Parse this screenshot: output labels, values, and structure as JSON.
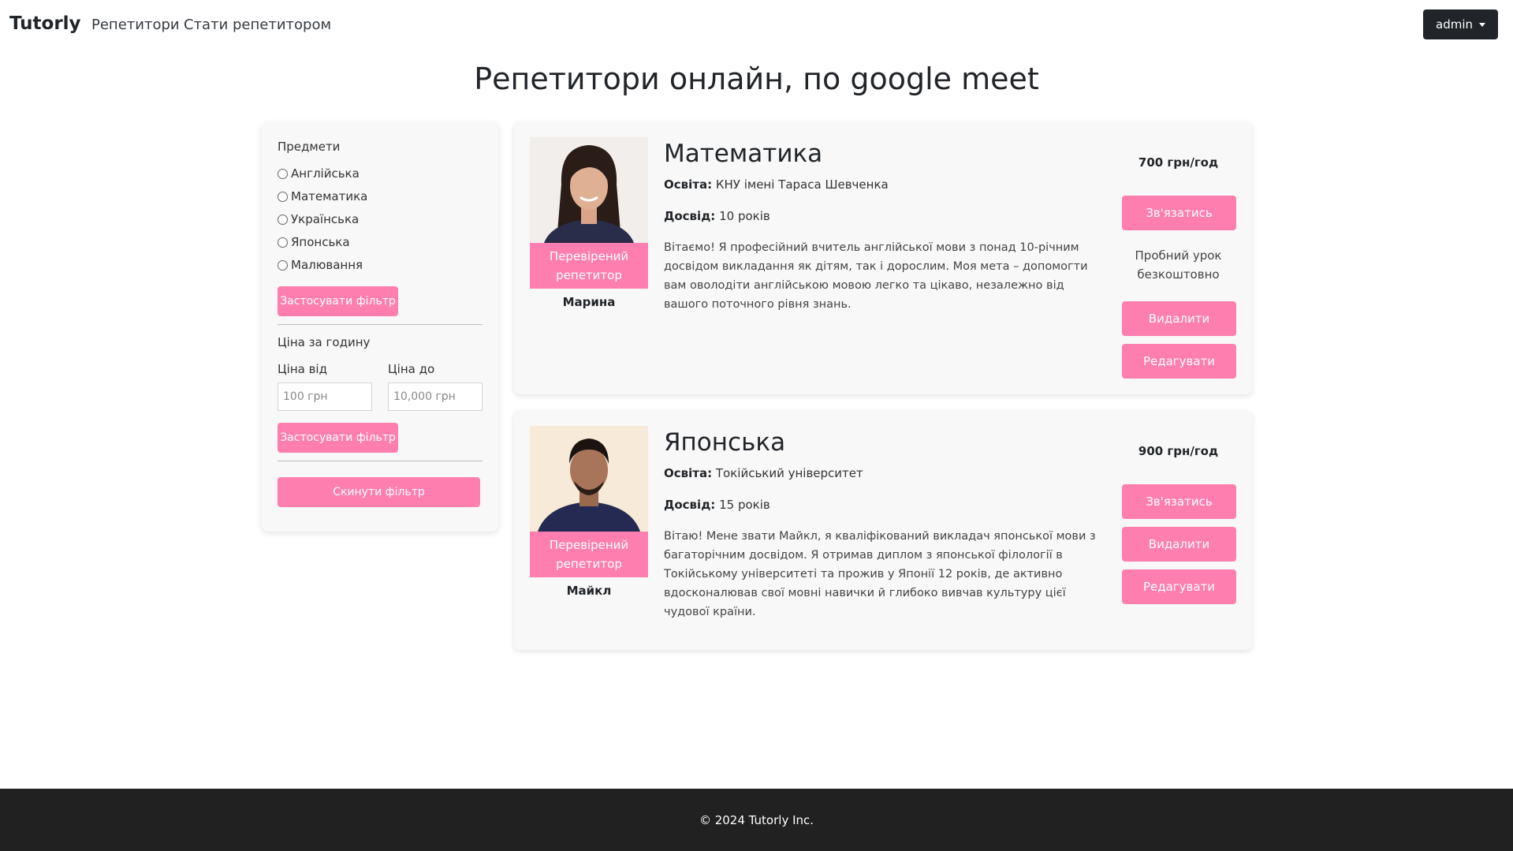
{
  "navbar": {
    "brand": "Tutorly",
    "links": [
      "Репетитори",
      "Стати репетитором"
    ],
    "user_label": "admin"
  },
  "page_title": "Репетитори онлайн, по google meet",
  "filter": {
    "subjects_label": "Предмети",
    "subjects": [
      "Англійська",
      "Математика",
      "Українська",
      "Японська",
      "Малювання"
    ],
    "apply_label": "Застосувати фільтр",
    "price_label": "Ціна за годину",
    "price_from_label": "Ціна від",
    "price_to_label": "Ціна до",
    "price_from_placeholder": "100 грн",
    "price_to_placeholder": "10,000 грн",
    "reset_label": "Скинути фільтр"
  },
  "tutors": [
    {
      "subject": "Математика",
      "education_label": "Освіта:",
      "education": "КНУ імені Тараса Шевченка",
      "experience_label": "Досвід:",
      "experience": "10 років",
      "about": "Вітаємо! Я професійний вчитель англійської мови з понад 10-річним досвідом викладання як дітям, так і дорослим. Моя мета – допомогти вам оволодіти англійською мовою легко та цікаво, незалежно від вашого поточного рівня знань.",
      "verified_label": "Перевірений репетитор",
      "name": "Марина",
      "price": "700 грн/год",
      "contact_label": "Зв'язатись",
      "trial_label": "Пробний урок безкоштовно",
      "delete_label": "Видалити",
      "edit_label": "Редагувати"
    },
    {
      "subject": "Японська",
      "education_label": "Освіта:",
      "education": "Токійський університет",
      "experience_label": "Досвід:",
      "experience": "15 років",
      "about": "Вітаю! Мене звати Майкл, я кваліфікований викладач японської мови з багаторічним досвідом. Я отримав диплом з японської філології в Токійському університеті та прожив у Японії 12 років, де активно вдосконалював свої мовні навички й глибоко вивчав культуру цієї чудової країни.",
      "verified_label": "Перевірений репетитор",
      "name": "Майкл",
      "price": "900 грн/год",
      "contact_label": "Зв'язатись",
      "delete_label": "Видалити",
      "edit_label": "Редагувати"
    }
  ],
  "footer": {
    "copyright": "© 2024 Tutorly Inc."
  },
  "colors": {
    "accent": "#ff7eb0",
    "dark": "#212529",
    "footer_bg": "#212121"
  }
}
